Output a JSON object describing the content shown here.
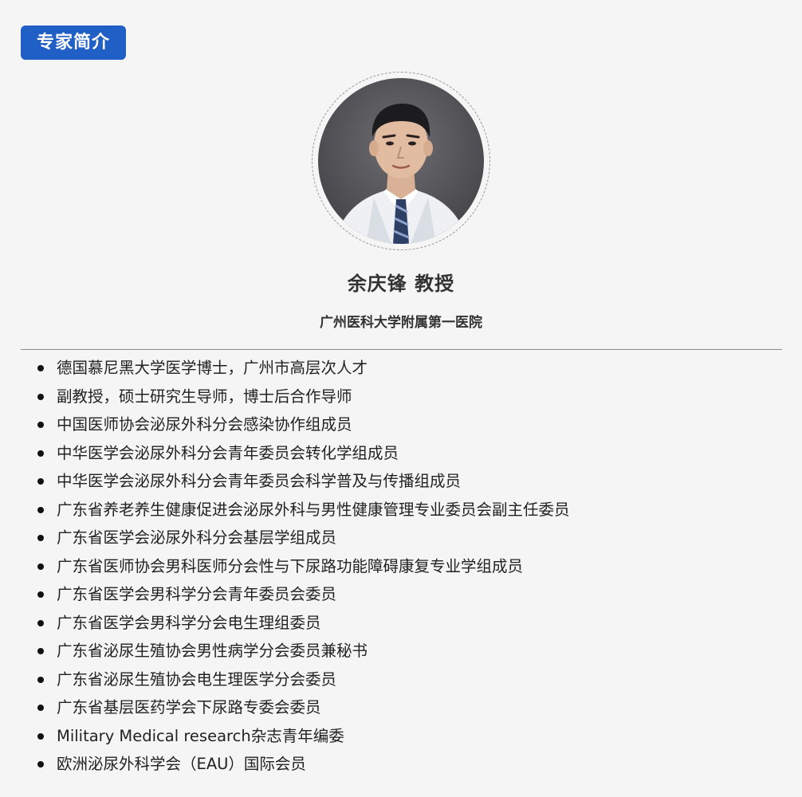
{
  "header": {
    "badge_label": "专家简介"
  },
  "profile": {
    "name": "余庆锋 教授",
    "hospital": "广州医科大学附属第一医院",
    "avatar_icon": "person-portrait"
  },
  "credentials": [
    "德国慕尼黑大学医学博士，广州市高层次人才",
    "副教授，硕士研究生导师，博士后合作导师",
    "中国医师协会泌尿外科分会感染协作组成员",
    "中华医学会泌尿外科分会青年委员会转化学组成员",
    "中华医学会泌尿外科分会青年委员会科学普及与传播组成员",
    "广东省养老养生健康促进会泌尿外科与男性健康管理专业委员会副主任委员",
    "广东省医学会泌尿外科分会基层学组成员",
    "广东省医师协会男科医师分会性与下尿路功能障碍康复专业学组成员",
    "广东省医学会男科学分会青年委员会委员",
    "广东省医学会男科学分会电生理组委员",
    "广东省泌尿生殖协会男性病学分会委员兼秘书",
    "广东省泌尿生殖协会电生理医学分会委员",
    "广东省基层医药学会下尿路专委会委员",
    "Military Medical research杂志青年编委",
    "欧洲泌尿外科学会（EAU）国际会员"
  ],
  "colors": {
    "badge_bg": "#1f5fc6",
    "page_bg": "#f5f5f5",
    "text": "#222222"
  }
}
